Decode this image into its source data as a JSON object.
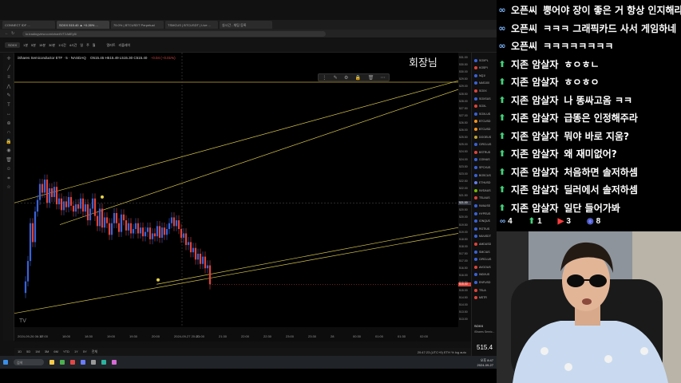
{
  "browser": {
    "tabs": [
      {
        "label": "CONNECT IDF ...",
        "active": false
      },
      {
        "label": "SOXX 515.40 ▲ +0.26% ...",
        "active": true
      },
      {
        "label": "75.0% | BTCUSDT Perpetual",
        "active": false
      },
      {
        "label": "TSMCUS | BTCUSDT | Live ...",
        "active": false
      },
      {
        "label": "실시간 - 채팅 등록",
        "active": false
      }
    ],
    "url": "kr.tradingview.com/chart/VT2A8Ey5/"
  },
  "toolbar": {
    "symbol": "SOXX",
    "intervals": [
      "1분",
      "5분",
      "15분",
      "30분",
      "1시간",
      "4시간",
      "일",
      "주",
      "월"
    ],
    "alert_label": "얼러트",
    "replay_label": "리플레이"
  },
  "chart": {
    "symbol_title": "iShares Semiconductor ETF · 5 · NASDAQ",
    "ohlc_text": "O515.45 H515.49 L515.30 C515.40",
    "change_text": "−0.04 (−0.01%)",
    "host_label": "회장님",
    "price_ticks": [
      "531.00",
      "530.50",
      "530.00",
      "529.50",
      "529.00",
      "528.50",
      "528.00",
      "527.50",
      "527.00",
      "526.50",
      "526.00",
      "525.50",
      "525.00",
      "524.50",
      "524.00",
      "523.50",
      "523.00",
      "522.50",
      "522.00",
      "521.50",
      "521.00",
      "520.50",
      "520.00",
      "519.50",
      "519.00",
      "518.50",
      "518.00",
      "517.50",
      "517.00",
      "516.50",
      "516.00",
      "515.50",
      "515.00",
      "514.50",
      "514.00",
      "513.50",
      "513.00"
    ],
    "last_price_label": "515.40",
    "crosshair_price_label": "521.00",
    "time_ticks": [
      "2024-09-26 06:10",
      "17:00",
      "18:00",
      "18:30",
      "19:00",
      "19:30",
      "20:00",
      "2024-09-27 20:20",
      "21:00",
      "21:30",
      "22:00",
      "22:30",
      "23:00",
      "23:30",
      "28",
      "00:30",
      "01:00",
      "01:30",
      "02:00"
    ],
    "range_buttons": [
      "1D",
      "5D",
      "1M",
      "3M",
      "6M",
      "YTD",
      "1Y",
      "5Y",
      "전체"
    ],
    "bottom_status": "20:47:23 (UTC+9)   ETH   %   log   auto"
  },
  "chart_data": {
    "type": "candlestick",
    "x": [
      1,
      2,
      3,
      4,
      5,
      6,
      7,
      8,
      9,
      10,
      11,
      12,
      13,
      14,
      15,
      16,
      17,
      18,
      19,
      20,
      21,
      22,
      23,
      24,
      25,
      26,
      27,
      28,
      29,
      30,
      31,
      32,
      33,
      34,
      35,
      36,
      37,
      38,
      39,
      40,
      41,
      42,
      43,
      44,
      45,
      46,
      47,
      48,
      49,
      50,
      51,
      52,
      53,
      54,
      55,
      56,
      57,
      58,
      59,
      60,
      61,
      62,
      63,
      64,
      65,
      66,
      67,
      68,
      69,
      70,
      71,
      72,
      73,
      74,
      75,
      76,
      77,
      78
    ],
    "close": [
      515.6,
      517.0,
      519.6,
      518.3,
      520.4,
      521.2,
      522.3,
      521.7,
      522.6,
      521.0,
      522.0,
      521.4,
      522.1,
      520.9,
      521.3,
      520.5,
      521.1,
      520.7,
      521.4,
      520.8,
      520.4,
      520.9,
      520.6,
      521.3,
      520.4,
      520.9,
      519.8,
      520.6,
      521.3,
      520.1,
      519.4,
      520.6,
      519.3,
      520.0,
      519.6,
      518.8,
      519.6,
      520.3,
      519.6,
      519.0,
      520.2,
      519.8,
      519.1,
      519.6,
      518.9,
      519.2,
      519.6,
      518.9,
      519.3,
      518.7,
      519.0,
      519.3,
      518.5,
      518.9,
      518.7,
      519.4,
      518.6,
      519.3,
      518.8,
      519.2,
      519.6,
      520.0,
      519.4,
      519.8,
      519.2,
      518.6,
      518.9,
      518.1,
      518.3,
      517.6,
      517.9,
      517.1,
      517.5,
      516.8,
      517.3,
      516.5,
      516.7,
      515.4
    ],
    "ylim": [
      513.0,
      531.0
    ],
    "trendlines": [
      {
        "from": [
          0,
          521.0
        ],
        "to": [
          78,
          529.4
        ],
        "color": "#d6c54a"
      },
      {
        "from": [
          8,
          519.5
        ],
        "to": [
          78,
          528.8
        ],
        "color": "#d6c54a"
      },
      {
        "from": [
          0,
          513.4
        ],
        "to": [
          78,
          518.9
        ],
        "color": "#d6c54a"
      },
      {
        "from": [
          25,
          515.4
        ],
        "to": [
          78,
          519.3
        ],
        "color": "#d6c54a"
      }
    ],
    "horizontal_line": 529.3,
    "up_color": "#3a62d8",
    "down_color": "#e0443a"
  },
  "watchlist": {
    "items": [
      {
        "sym": "SOXPL",
        "color": "#3a62d8"
      },
      {
        "sym": "KOSPI",
        "color": "#e0443a"
      },
      {
        "sym": "NQ1!",
        "color": "#3a62d8"
      },
      {
        "sym": "NAS100",
        "color": "#3a62d8"
      },
      {
        "sym": "SOXX",
        "color": "#e0443a"
      },
      {
        "sym": "SOXSUS",
        "color": "#3a62d8"
      },
      {
        "sym": "SOXL",
        "color": "#e0443a"
      },
      {
        "sym": "SOXLUS",
        "color": "#3a62d8"
      },
      {
        "sym": "BTCUSD",
        "color": "#f7931a"
      },
      {
        "sym": "BTCUSD",
        "color": "#f7931a"
      },
      {
        "sym": "DOGEUS",
        "color": "#c2a633"
      },
      {
        "sym": "CIRCLUS",
        "color": "#3a62d8"
      },
      {
        "sym": "BSTRUS",
        "color": "#e0443a"
      },
      {
        "sym": "COINUS",
        "color": "#3a62d8"
      },
      {
        "sym": "SPCXUS",
        "color": "#3a62d8"
      },
      {
        "sym": "BGSCUS",
        "color": "#3a62d8"
      },
      {
        "sym": "ETHUSD",
        "color": "#627eea"
      },
      {
        "sym": "NVDAUS",
        "color": "#76b900"
      },
      {
        "sym": "TSLAUS",
        "color": "#e0443a"
      },
      {
        "sym": "NVAUSS",
        "color": "#3a62d8"
      },
      {
        "sym": "HYPEUS",
        "color": "#3a62d8"
      },
      {
        "sym": "IONQUS",
        "color": "#3a62d8"
      },
      {
        "sym": "RGTIUS",
        "color": "#3a62d8"
      },
      {
        "sym": "MUUSDT",
        "color": "#3a62d8"
      },
      {
        "sym": "AMDUSD",
        "color": "#e0443a"
      },
      {
        "sym": "SMCIUS",
        "color": "#3a62d8"
      },
      {
        "sym": "CIRCLUS",
        "color": "#3a62d8"
      },
      {
        "sym": "AVGOUS",
        "color": "#e0443a"
      },
      {
        "sym": "INDXUS",
        "color": "#3a62d8"
      },
      {
        "sym": "ENFUSD",
        "color": "#3a62d8"
      },
      {
        "sym": "TSLA",
        "color": "#e0443a"
      },
      {
        "sym": "MSTR",
        "color": "#e0443a"
      }
    ],
    "detail_symbol": "SOXX",
    "detail_name": "iShares Semic...",
    "detail_price": "515.4"
  },
  "taskbar": {
    "search_placeholder": "검색",
    "clock_time": "오후 8:47",
    "clock_date": "2024-09-27"
  },
  "chat": {
    "messages": [
      {
        "icon": "∞",
        "name": "오픈씨",
        "text": "뿡어야 장이 좋은 거 항상 인지해라",
        "color": "#7fb8ff"
      },
      {
        "icon": "∞",
        "name": "오픈씨",
        "text": "ㅋㅋㅋ 그래픽카드 사서 게임하네",
        "color": "#7fb8ff"
      },
      {
        "icon": "∞",
        "name": "오픈씨",
        "text": "ㅋㅋㅋㅋㅋㅋㅋㅋ",
        "color": "#7fb8ff"
      },
      {
        "icon": "⬆",
        "name": "지존 암살자",
        "text": "ㅎㅇㅎㄴ",
        "color": "#43d17a"
      },
      {
        "icon": "⬆",
        "name": "지존 암살자",
        "text": "ㅎㅇㅎㅇ",
        "color": "#43d17a"
      },
      {
        "icon": "⬆",
        "name": "지존 암살자",
        "text": "나 똥싸고옴 ㅋㅋ",
        "color": "#43d17a"
      },
      {
        "icon": "⬆",
        "name": "지존 암살자",
        "text": "급똥은 인정해주라",
        "color": "#43d17a"
      },
      {
        "icon": "⬆",
        "name": "지존 암살자",
        "text": "뭐야 바로 지움?",
        "color": "#43d17a"
      },
      {
        "icon": "⬆",
        "name": "지존 암살자",
        "text": "왜 재미없어?",
        "color": "#43d17a"
      },
      {
        "icon": "⬆",
        "name": "지존 암살자",
        "text": "처음하면 솔저하셈",
        "color": "#43d17a"
      },
      {
        "icon": "⬆",
        "name": "지존 암살자",
        "text": "딜러에서 솔저하셈",
        "color": "#43d17a"
      },
      {
        "icon": "⬆",
        "name": "지존 암살자",
        "text": "일단 들어가봐",
        "color": "#43d17a"
      }
    ],
    "counts": [
      {
        "icon": "∞",
        "value": "4",
        "color": "#7fb8ff"
      },
      {
        "icon": "⬆",
        "value": "1",
        "color": "#43d17a"
      },
      {
        "icon": "▶",
        "value": "3",
        "color": "#ff3b3b"
      },
      {
        "icon": "◉",
        "value": "8",
        "color": "#6b7bff"
      }
    ]
  }
}
